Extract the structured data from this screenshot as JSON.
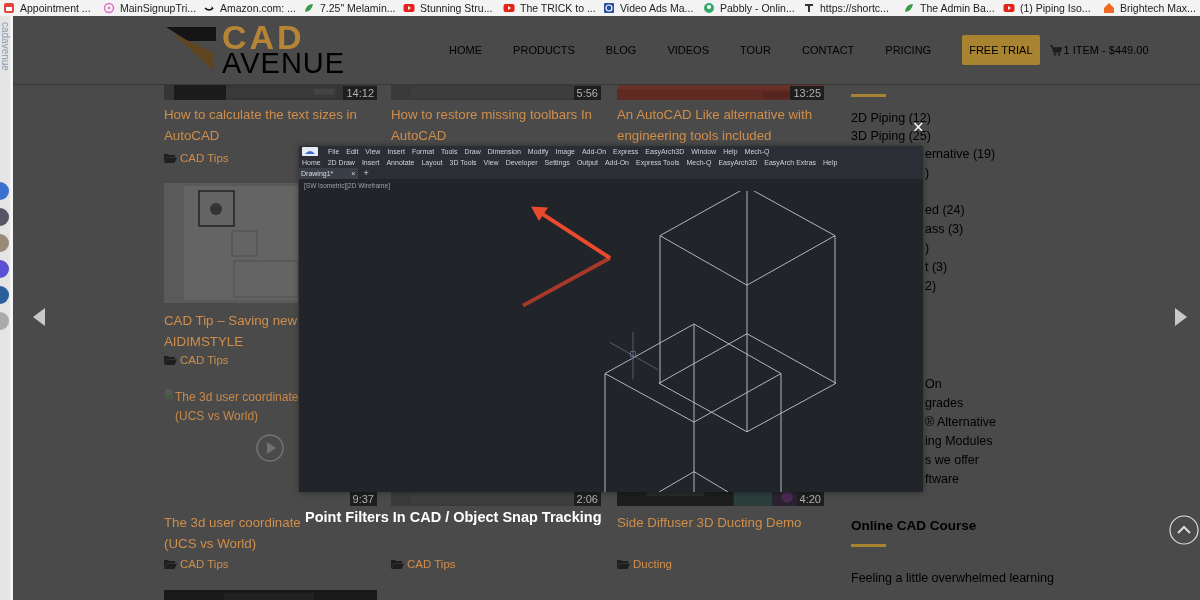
{
  "bookmarks": [
    {
      "label": "Appointment ..."
    },
    {
      "label": "MainSignupTri..."
    },
    {
      "label": "Amazon.com: ..."
    },
    {
      "label": "7.25\" Melamin..."
    },
    {
      "label": "Stunning Stru..."
    },
    {
      "label": "The TRICK to ..."
    },
    {
      "label": "Video Ads Ma..."
    },
    {
      "label": "Pabbly - Onlin..."
    },
    {
      "label": "https://shortc..."
    },
    {
      "label": "The Admin Ba..."
    },
    {
      "label": "(1) Piping Iso..."
    },
    {
      "label": "Brightech Max..."
    }
  ],
  "side_panel": {
    "label": "cadavenue"
  },
  "site": {
    "logo": {
      "line1": "CAD",
      "line2": "AVENUE"
    },
    "nav": [
      {
        "label": "HOME",
        "kind": "link"
      },
      {
        "label": "PRODUCTS",
        "kind": "link"
      },
      {
        "label": "BLOG",
        "kind": "link"
      },
      {
        "label": "VIDEOS",
        "kind": "link"
      },
      {
        "label": "TOUR",
        "kind": "link"
      },
      {
        "label": "CONTACT",
        "kind": "link"
      },
      {
        "label": "PRICING",
        "kind": "link"
      },
      {
        "label": "FREE TRIAL",
        "kind": "button"
      }
    ],
    "cart": "1 ITEM - $449.00"
  },
  "post_columns": [
    [
      {
        "kind": "thumb",
        "duration": "14:12"
      },
      {
        "kind": "title",
        "lines": [
          "How to calculate the text sizes in",
          "AutoCAD"
        ]
      },
      {
        "kind": "category",
        "text": "CAD Tips"
      },
      {
        "kind": "thumb"
      },
      {
        "kind": "title",
        "lines": [
          "CAD Tip – Saving new",
          "AIDIMSTYLE"
        ]
      },
      {
        "kind": "category",
        "text": "CAD Tips"
      },
      {
        "kind": "broken_image",
        "alt_lines": [
          "The 3d user coordinate",
          "(UCS vs World)"
        ],
        "duration": "9:37"
      },
      {
        "kind": "title",
        "lines": [
          "The 3d user coordinate",
          "(UCS vs World)"
        ]
      },
      {
        "kind": "category",
        "text": "CAD Tips"
      },
      {
        "kind": "thumb"
      }
    ],
    [
      {
        "kind": "thumb",
        "duration": "5:56"
      },
      {
        "kind": "title",
        "lines": [
          "How to restore missing toolbars In",
          "AutoCAD"
        ]
      },
      {
        "kind": "thumb",
        "duration": "2:06"
      },
      {
        "kind": "category",
        "text": "CAD Tips"
      }
    ],
    [
      {
        "kind": "thumb",
        "duration": "13:25"
      },
      {
        "kind": "title",
        "lines": [
          "An AutoCAD Like alternative with",
          "engineering tools included"
        ]
      },
      {
        "kind": "thumb",
        "duration": "4:20"
      },
      {
        "kind": "title",
        "lines": [
          "Side Diffuser 3D Ducting Demo"
        ]
      },
      {
        "kind": "category",
        "text": "Ducting"
      }
    ]
  ],
  "sidebar": {
    "categories": [
      "2D Piping (12)",
      "3D Piping (25)"
    ],
    "fragment_groups": [
      [
        "ernative (19)",
        ")"
      ],
      [
        "ed (24)",
        "ass (3)",
        ")",
        "t (3)",
        "2)"
      ],
      [
        "On",
        "grades",
        "® Alternative",
        "ing Modules",
        "s we offer",
        "ftware"
      ]
    ],
    "course_widget": {
      "title": "Online CAD Course",
      "text": "Feeling a little overwhelmed learning"
    }
  },
  "lightbox": {
    "close": "×",
    "caption": "Point Filters In CAD / Object Snap Tracking",
    "app": {
      "menu": [
        "File",
        "Edit",
        "View",
        "Insert",
        "Format",
        "Tools",
        "Draw",
        "Dimension",
        "Modify",
        "Image",
        "Add-On",
        "Express",
        "EasyArch3D",
        "Window",
        "Help",
        "Mech-Q"
      ],
      "ribbon_tabs": [
        "Home",
        "2D Draw",
        "Insert",
        "Annotate",
        "Layout",
        "3D Tools",
        "View",
        "Developer",
        "Settings",
        "Output",
        "Add-On",
        "Express Tools",
        "Mech-Q",
        "EasyArch3D",
        "EasyArch Extras",
        "Help"
      ],
      "document_tab": {
        "label": "Drawing1*",
        "close": "×"
      },
      "new_tab": "+",
      "viewport_label": "[SW Isometric][2D Wireframe]"
    }
  }
}
